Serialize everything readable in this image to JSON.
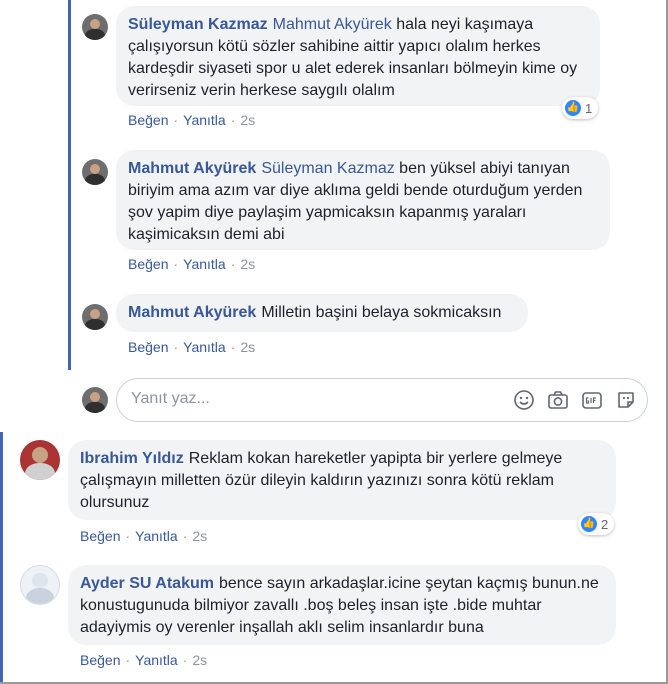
{
  "comments": [
    {
      "author": "Süleyman Kazmaz",
      "mention": "Mahmut Akyürek",
      "text": "hala neyi kaşımaya çalışıyorsun kötü sözler sahibine aittir yapıcı olalım herkes kardeşdir siyaseti spor u alet ederek insanları bölmeyin kime oy verirseniz verin herkese saygılı olalım",
      "like": "Beğen",
      "reply": "Yanıtla",
      "time": "2s",
      "reactions": "1"
    },
    {
      "author": "Mahmut Akyürek",
      "mention": "Süleyman Kazmaz",
      "text": "ben yüksel abiyi tanıyan biriyim ama azım var diye aklıma geldi bende oturduğum yerden şov yapim diye paylaşim yapmicaksın kapanmış yaraları kaşimicaksın demi abi",
      "like": "Beğen",
      "reply": "Yanıtla",
      "time": "2s"
    },
    {
      "author": "Mahmut Akyürek",
      "text": "Milletin başini belaya sokmicaksın",
      "like": "Beğen",
      "reply": "Yanıtla",
      "time": "2s"
    },
    {
      "author": "Ibrahim Yıldız",
      "text": "Reklam kokan hareketler yapipta bir yerlere gelmeye çalışmayın milletten özür dileyin kaldırın yazınızı sonra kötü reklam olursunuz",
      "like": "Beğen",
      "reply": "Yanıtla",
      "time": "2s",
      "reactions": "2"
    },
    {
      "author": "Ayder SU Atakum",
      "text": "bence sayın arkadaşlar.icine şeytan kaçmış bunun.ne konustugunuda bilmiyor zavallı .boş beleş insan işte .bide muhtar adayiymis oy verenler inşallah aklı selim insanlardır buna",
      "like": "Beğen",
      "reply": "Yanıtla",
      "time": "2s"
    }
  ],
  "reply_box": {
    "placeholder": "Yanıt yaz..."
  },
  "icons": [
    "emoji-icon",
    "camera-icon",
    "gif-icon",
    "sticker-icon"
  ],
  "colors": {
    "link": "#385898",
    "thread": "#4267b2",
    "bubble": "#f2f3f5",
    "like": "#2d88ff"
  }
}
